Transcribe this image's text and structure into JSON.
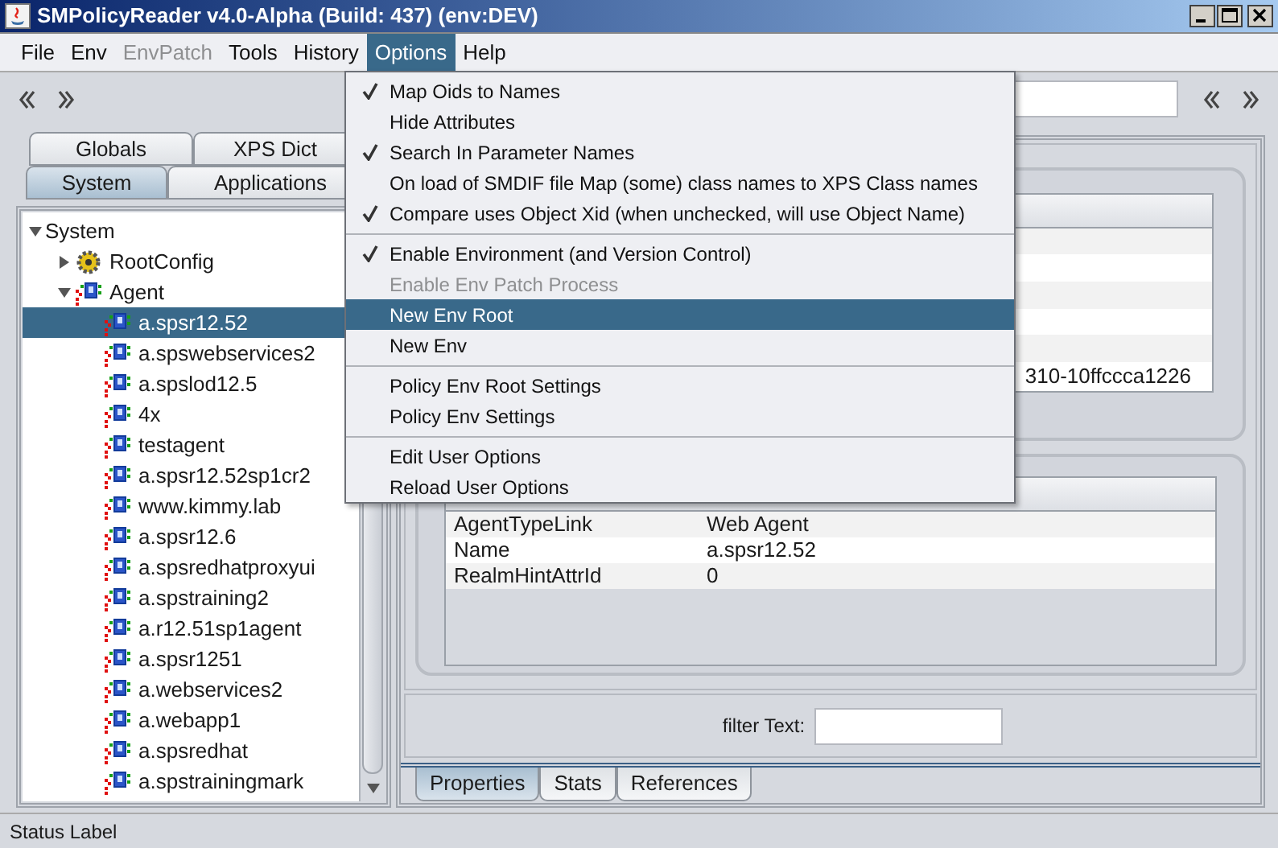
{
  "window": {
    "title": "SMPolicyReader v4.0-Alpha (Build: 437) (env:DEV)"
  },
  "menu_bar": [
    {
      "label": "File",
      "selected": false,
      "disabled": false
    },
    {
      "label": "Env",
      "selected": false,
      "disabled": false
    },
    {
      "label": "EnvPatch",
      "selected": false,
      "disabled": true
    },
    {
      "label": "Tools",
      "selected": false,
      "disabled": false
    },
    {
      "label": "History",
      "selected": false,
      "disabled": false
    },
    {
      "label": "Options",
      "selected": true,
      "disabled": false
    },
    {
      "label": "Help",
      "selected": false,
      "disabled": false
    }
  ],
  "options_menu": [
    {
      "kind": "item",
      "label": "Map Oids to Names",
      "checked": true,
      "disabled": false,
      "selected": false
    },
    {
      "kind": "item",
      "label": "Hide Attributes",
      "checked": false,
      "disabled": false,
      "selected": false
    },
    {
      "kind": "item",
      "label": "Search In Parameter Names",
      "checked": true,
      "disabled": false,
      "selected": false
    },
    {
      "kind": "item",
      "label": "On load of SMDIF file Map (some) class names to XPS Class names",
      "checked": false,
      "disabled": false,
      "selected": false
    },
    {
      "kind": "item",
      "label": "Compare uses Object Xid (when unchecked, will use Object Name)",
      "checked": true,
      "disabled": false,
      "selected": false
    },
    {
      "kind": "separator"
    },
    {
      "kind": "item",
      "label": "Enable Environment (and Version Control)",
      "checked": true,
      "disabled": false,
      "selected": false
    },
    {
      "kind": "item",
      "label": "Enable Env Patch Process",
      "checked": false,
      "disabled": true,
      "selected": false
    },
    {
      "kind": "item",
      "label": "New Env Root",
      "checked": false,
      "disabled": false,
      "selected": true
    },
    {
      "kind": "item",
      "label": "New Env",
      "checked": false,
      "disabled": false,
      "selected": false
    },
    {
      "kind": "separator"
    },
    {
      "kind": "item",
      "label": "Policy Env Root Settings",
      "checked": false,
      "disabled": false,
      "selected": false
    },
    {
      "kind": "item",
      "label": "Policy Env Settings",
      "checked": false,
      "disabled": false,
      "selected": false
    },
    {
      "kind": "separator"
    },
    {
      "kind": "item",
      "label": "Edit User Options",
      "checked": false,
      "disabled": false,
      "selected": false
    },
    {
      "kind": "item",
      "label": "Reload User Options",
      "checked": false,
      "disabled": false,
      "selected": false
    }
  ],
  "left_tab_rows": [
    {
      "tabs": [
        {
          "label": "Globals",
          "selected": false
        },
        {
          "label": "XPS Dict",
          "selected": false
        }
      ]
    },
    {
      "tabs": [
        {
          "label": "System",
          "selected": true
        },
        {
          "label": "Applications",
          "selected": false
        }
      ]
    }
  ],
  "tree": [
    {
      "label": "System",
      "expanded": true,
      "selected": false,
      "children": [
        {
          "label": "RootConfig",
          "kind": "config",
          "expanded": false,
          "selected": false
        },
        {
          "label": "Agent",
          "kind": "agent",
          "expanded": true,
          "selected": false,
          "children": [
            {
              "label": "a.spsr12.52",
              "kind": "agent",
              "selected": true
            },
            {
              "label": "a.spswebservices2",
              "kind": "agent",
              "selected": false
            },
            {
              "label": "a.spslod12.5",
              "kind": "agent",
              "selected": false
            },
            {
              "label": "4x",
              "kind": "agent",
              "selected": false
            },
            {
              "label": "testagent",
              "kind": "agent",
              "selected": false
            },
            {
              "label": "a.spsr12.52sp1cr2",
              "kind": "agent",
              "selected": false
            },
            {
              "label": "www.kimmy.lab",
              "kind": "agent",
              "selected": false
            },
            {
              "label": "a.spsr12.6",
              "kind": "agent",
              "selected": false
            },
            {
              "label": "a.spsredhatproxyui",
              "kind": "agent",
              "selected": false
            },
            {
              "label": "a.spstraining2",
              "kind": "agent",
              "selected": false
            },
            {
              "label": "a.r12.51sp1agent",
              "kind": "agent",
              "selected": false
            },
            {
              "label": "a.spsr1251",
              "kind": "agent",
              "selected": false
            },
            {
              "label": "a.webservices2",
              "kind": "agent",
              "selected": false
            },
            {
              "label": "a.webapp1",
              "kind": "agent",
              "selected": false
            },
            {
              "label": "a.spsredhat",
              "kind": "agent",
              "selected": false
            },
            {
              "label": "a.spstrainingmark",
              "kind": "agent",
              "selected": false
            }
          ]
        }
      ]
    }
  ],
  "object_table": {
    "visible_cell": "310-10ffccca1226"
  },
  "properties_table": {
    "rows": [
      {
        "property": "AgentTypeLink",
        "value": "Web Agent"
      },
      {
        "property": "Name",
        "value": "a.spsr12.52"
      },
      {
        "property": "RealmHintAttrId",
        "value": "0"
      }
    ]
  },
  "filter": {
    "label": "filter Text:"
  },
  "bottom_tabs": [
    {
      "label": "Properties",
      "selected": true
    },
    {
      "label": "Stats",
      "selected": false
    },
    {
      "label": "References",
      "selected": false
    }
  ],
  "status_bar": {
    "text": "Status Label"
  }
}
